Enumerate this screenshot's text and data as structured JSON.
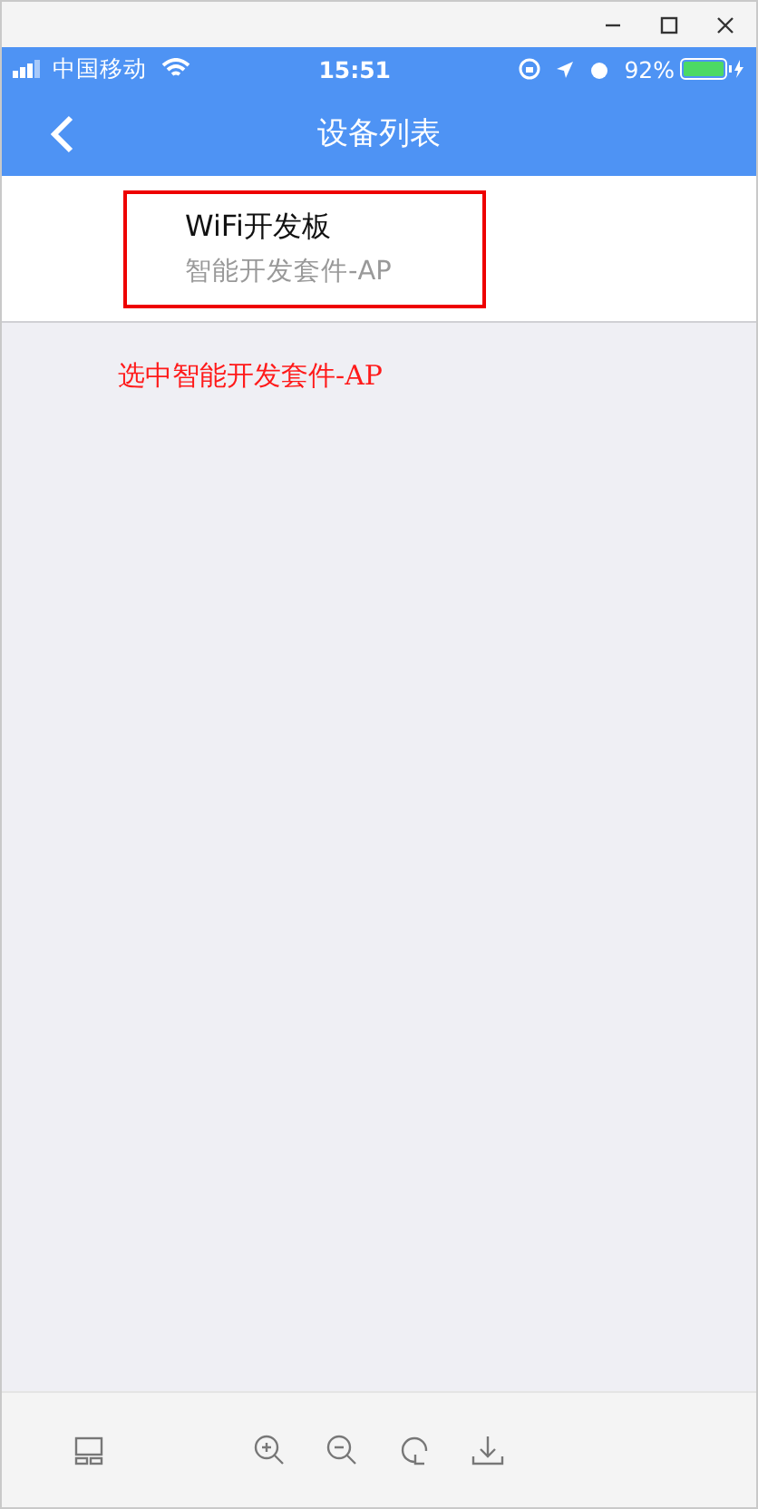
{
  "status_bar": {
    "carrier": "中国移动",
    "time": "15:51",
    "battery": "92%"
  },
  "nav": {
    "title": "设备列表"
  },
  "devices": [
    {
      "name": "WiFi开发板",
      "subtitle": "智能开发套件-AP",
      "highlighted": true
    }
  ],
  "annotation": "选中智能开发套件-AP"
}
